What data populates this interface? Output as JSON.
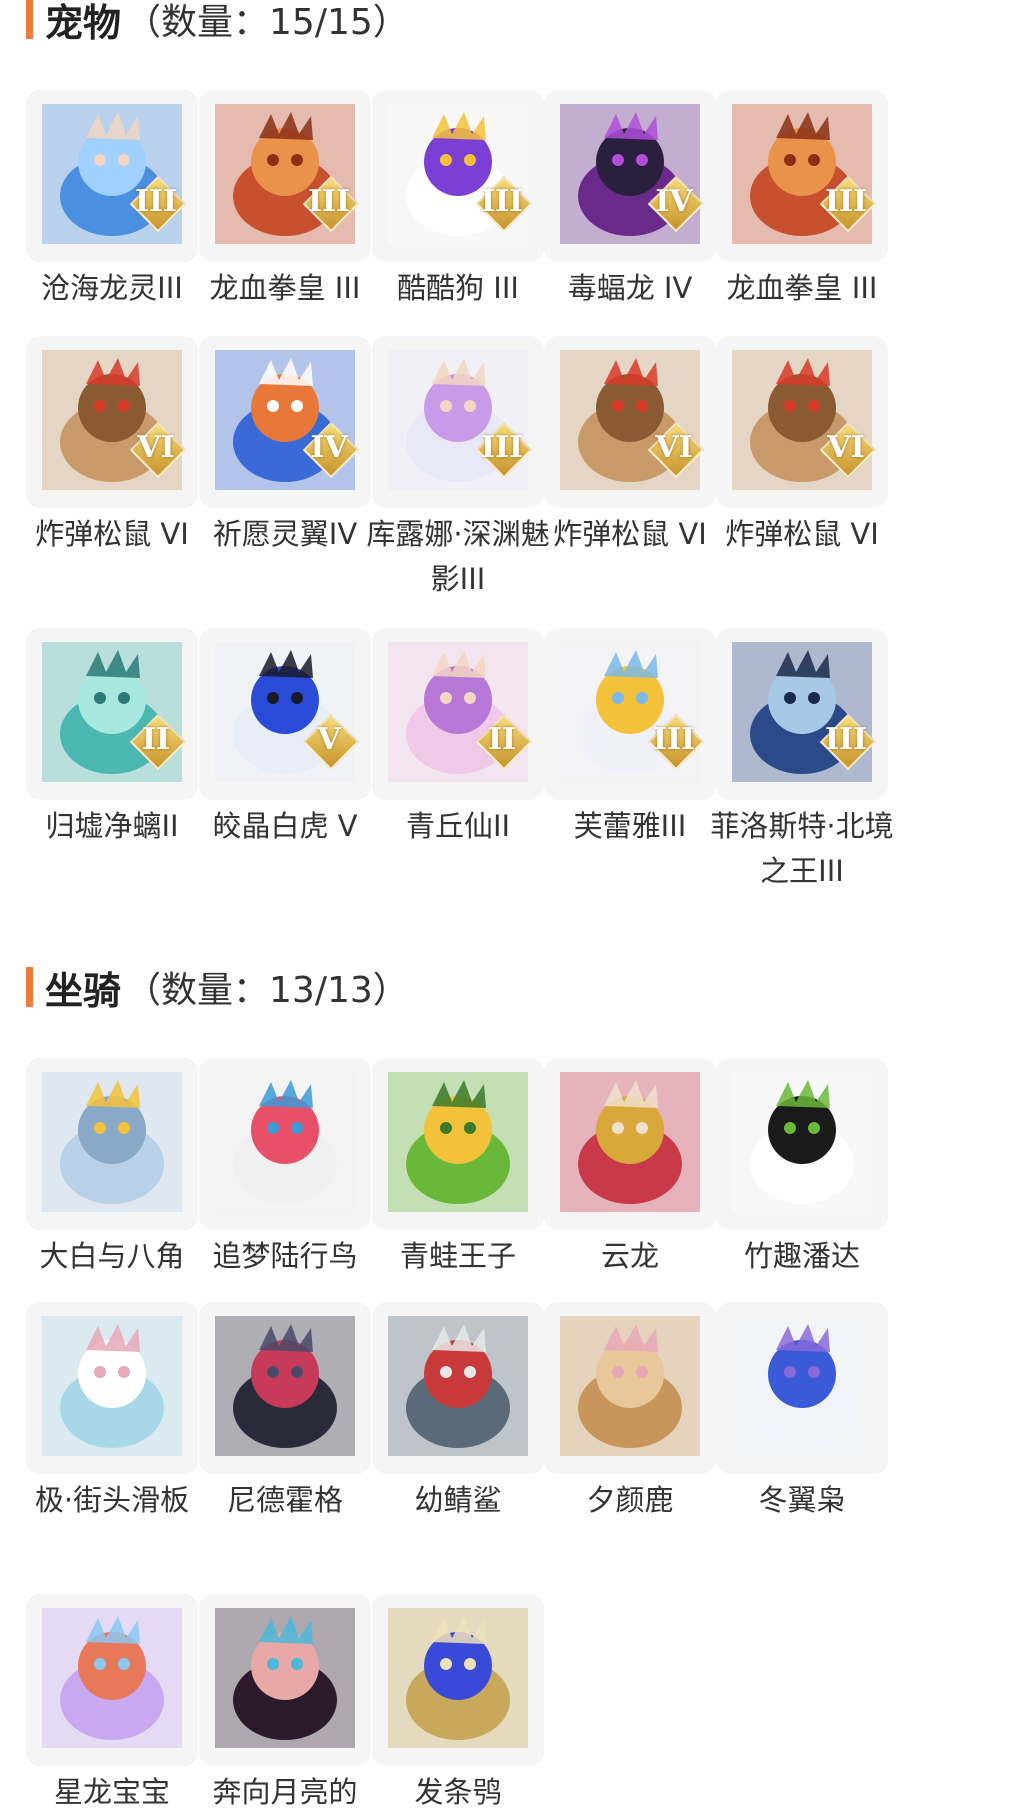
{
  "pets": {
    "title": "宠物",
    "count": "（数量：15/15）",
    "items": [
      {
        "name": "沧海龙灵III",
        "rank": "III",
        "icon": "blue-dragon-spirit-icon"
      },
      {
        "name": "龙血拳皇 III",
        "rank": "III",
        "icon": "red-horned-beast-icon"
      },
      {
        "name": "酷酷狗 III",
        "rank": "III",
        "icon": "white-dog-goggles-icon"
      },
      {
        "name": "毒蝠龙 IV",
        "rank": "IV",
        "icon": "purple-bat-dragon-icon"
      },
      {
        "name": "龙血拳皇 III",
        "rank": "III",
        "icon": "red-horned-beast-icon"
      },
      {
        "name": "炸弹松鼠 VI",
        "rank": "VI",
        "icon": "bomb-squirrel-icon"
      },
      {
        "name": "祈愿灵翼IV",
        "rank": "IV",
        "icon": "wish-bird-icon"
      },
      {
        "name": "库露娜·深渊魅影III",
        "rank": "III",
        "icon": "white-haired-girl-icon"
      },
      {
        "name": "炸弹松鼠 VI",
        "rank": "VI",
        "icon": "bomb-squirrel-icon"
      },
      {
        "name": "炸弹松鼠 VI",
        "rank": "VI",
        "icon": "bomb-squirrel-icon"
      },
      {
        "name": "归墟净螭II",
        "rank": "II",
        "icon": "teal-dragon-icon"
      },
      {
        "name": "皎晶白虎 V",
        "rank": "V",
        "icon": "white-tiger-icon"
      },
      {
        "name": "青丘仙II",
        "rank": "II",
        "icon": "fox-fairy-icon"
      },
      {
        "name": "芙蕾雅III",
        "rank": "III",
        "icon": "winged-helmet-girl-icon"
      },
      {
        "name": "菲洛斯特·北境之王III",
        "rank": "III",
        "icon": "ice-king-icon"
      }
    ]
  },
  "mounts": {
    "title": "坐骑",
    "count": "（数量：13/13）",
    "items": [
      {
        "name": "大白与八角",
        "icon": "whale-icon"
      },
      {
        "name": "追梦陆行鸟",
        "icon": "headphone-bird-icon"
      },
      {
        "name": "青蛙王子",
        "icon": "frog-prince-icon"
      },
      {
        "name": "云龙",
        "icon": "cloud-dragon-icon"
      },
      {
        "name": "竹趣潘达",
        "icon": "panda-icon"
      },
      {
        "name": "极·街头滑板",
        "icon": "skateboard-icon"
      },
      {
        "name": "尼德霍格",
        "icon": "dark-dragon-icon"
      },
      {
        "name": "幼鲭鲨",
        "icon": "shark-icon"
      },
      {
        "name": "夕颜鹿",
        "icon": "deer-icon"
      },
      {
        "name": "冬翼枭",
        "icon": "winter-owl-icon"
      },
      {
        "name": "星龙宝宝",
        "icon": "star-dragon-baby-icon"
      },
      {
        "name": "奔向月亮的",
        "icon": "moon-pig-icon"
      },
      {
        "name": "发条鸮",
        "icon": "clockwork-owl-icon"
      }
    ]
  },
  "colors": {
    "accent": "#f07a3c",
    "thumb_bg": "#f5f5f5",
    "text": "#333333"
  }
}
